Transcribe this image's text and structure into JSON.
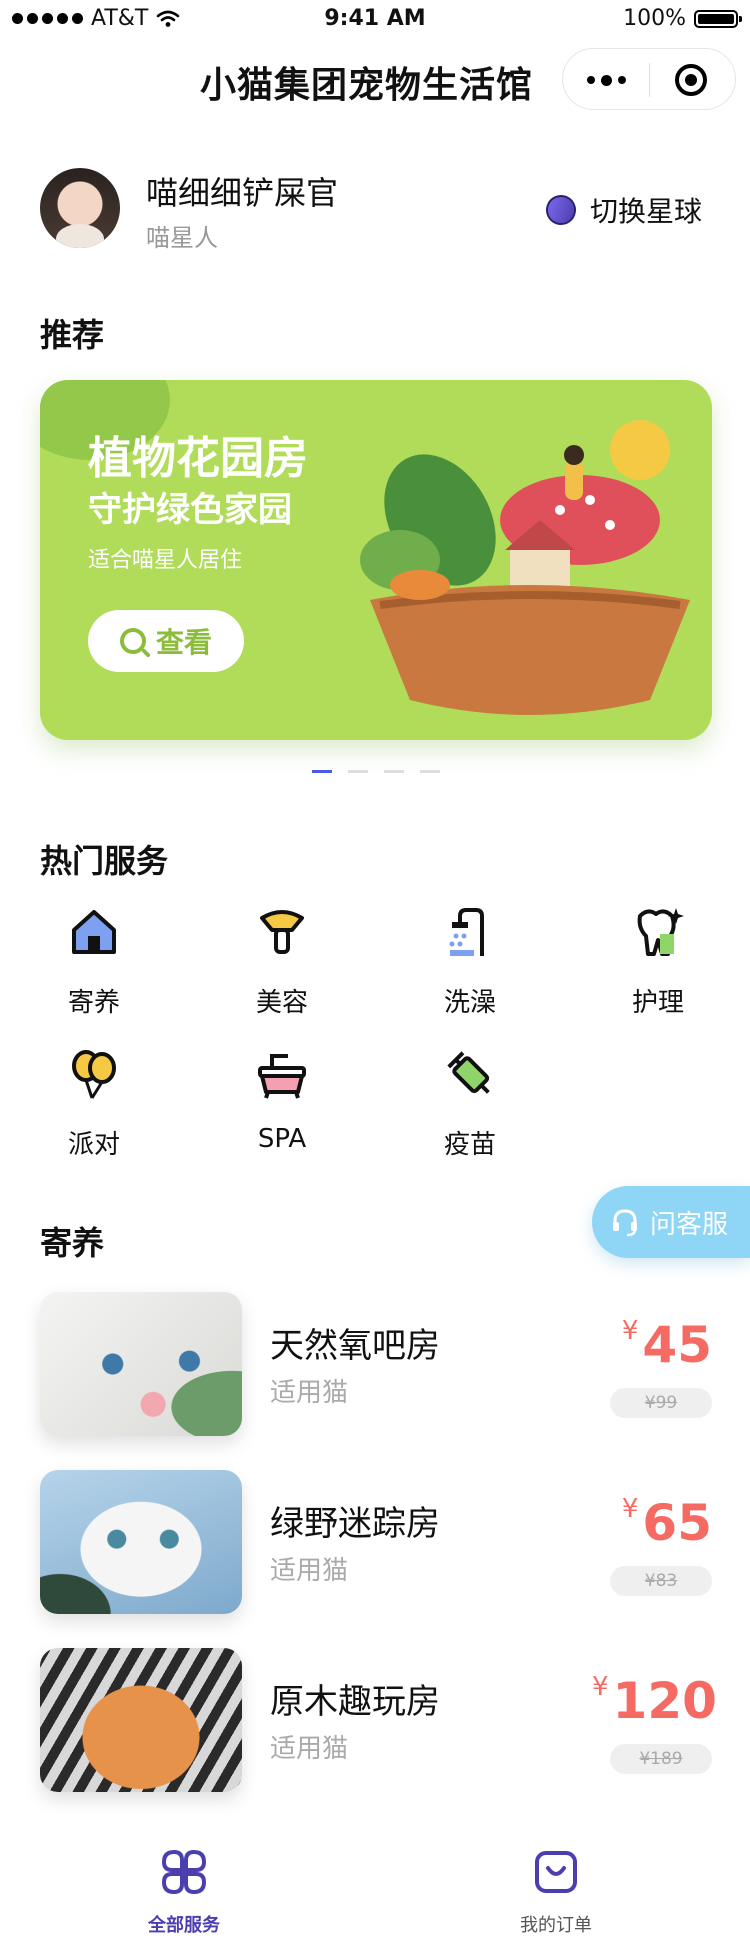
{
  "status_bar": {
    "carrier": "AT&T",
    "time": "9:41 AM",
    "battery": "100%"
  },
  "nav": {
    "title": "小猫集团宠物生活馆"
  },
  "user": {
    "name": "喵细细铲屎官",
    "subtitle": "喵星人",
    "switch_label": "切换星球"
  },
  "recommend": {
    "title": "推荐",
    "banner": {
      "title": "植物花园房",
      "subtitle": "守护绿色家园",
      "desc": "适合喵星人居住",
      "button": "查看"
    },
    "pager": {
      "count": 4,
      "active": 1
    }
  },
  "services": {
    "title": "热门服务",
    "items": [
      {
        "label": "寄养",
        "icon": "house-icon"
      },
      {
        "label": "美容",
        "icon": "grooming-icon"
      },
      {
        "label": "洗澡",
        "icon": "shower-icon"
      },
      {
        "label": "护理",
        "icon": "tooth-care-icon"
      },
      {
        "label": "派对",
        "icon": "balloon-icon"
      },
      {
        "label": "SPA",
        "icon": "bathtub-icon"
      },
      {
        "label": "疫苗",
        "icon": "syringe-icon"
      }
    ]
  },
  "customer_service": {
    "label": "问客服"
  },
  "boarding": {
    "title": "寄养",
    "items": [
      {
        "name": "天然氧吧房",
        "sub": "适用猫",
        "currency": "¥",
        "price": "45",
        "old_price": "¥99"
      },
      {
        "name": "绿野迷踪房",
        "sub": "适用猫",
        "currency": "¥",
        "price": "65",
        "old_price": "¥83"
      },
      {
        "name": "原木趣玩房",
        "sub": "适用猫",
        "currency": "¥",
        "price": "120",
        "old_price": "¥189"
      }
    ]
  },
  "tabbar": {
    "items": [
      {
        "label": "全部服务",
        "active": true
      },
      {
        "label": "我的订单",
        "active": false
      }
    ]
  },
  "colors": {
    "accent": "#4b3fb0",
    "price": "#f56b63",
    "banner": "#b0dc5a",
    "service_button": "#8fd5f5"
  }
}
